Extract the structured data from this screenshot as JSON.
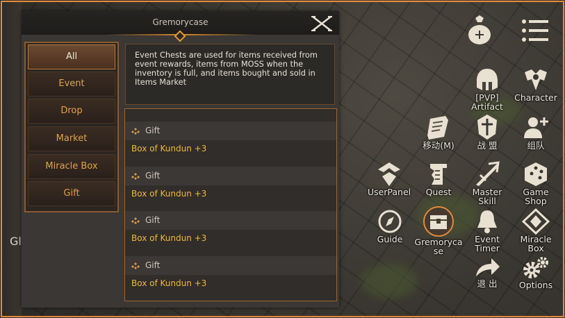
{
  "panel": {
    "title": "Gremorycase",
    "tabs": [
      "All",
      "Event",
      "Drop",
      "Market",
      "Miracle Box",
      "Gift"
    ],
    "active_tab_index": 0,
    "description": "Event Chests are used for items received from event rewards, items from MOSS when the inventory is full, and items bought and sold in Items Market",
    "items": [
      {
        "type": "Gift",
        "name": "Box of Kundun +3"
      },
      {
        "type": "Gift",
        "name": "Box of Kundun +3"
      },
      {
        "type": "Gift",
        "name": "Box of Kundun +3"
      },
      {
        "type": "Gift",
        "name": "Box of Kundun +3"
      }
    ]
  },
  "edge_text": "Gl",
  "hud": {
    "pvp_artifact": "[PVP] Artifact",
    "character": "Character",
    "move": "移动(M)",
    "guild": "战 盟",
    "team": "组队",
    "user_panel": "UserPanel",
    "quest": "Quest",
    "master_skill": "Master Skill",
    "game_shop": "Game Shop",
    "guide": "Guide",
    "gremorycase": "Gremoryca se",
    "event_timer": "Event Timer",
    "miracle_box": "Miracle Box",
    "exit": "退 出",
    "options": "Options"
  },
  "colors": {
    "accent_orange": "#e48a3a",
    "item_name_gold": "#f0b93a",
    "tab_text": "#e0a24a",
    "panel_bg": "#3a3734"
  },
  "icons": [
    "close-icon",
    "gift-icon",
    "bag-icon",
    "menu-icon",
    "helmet-icon",
    "character-icon",
    "scroll-icon",
    "guild-icon",
    "add-user-icon",
    "user-panel-icon",
    "quest-icon",
    "sword-icon",
    "dice-icon",
    "compass-icon",
    "chest-icon",
    "bell-icon",
    "miracle-box-icon",
    "exit-arrow-icon",
    "gear-icon"
  ]
}
